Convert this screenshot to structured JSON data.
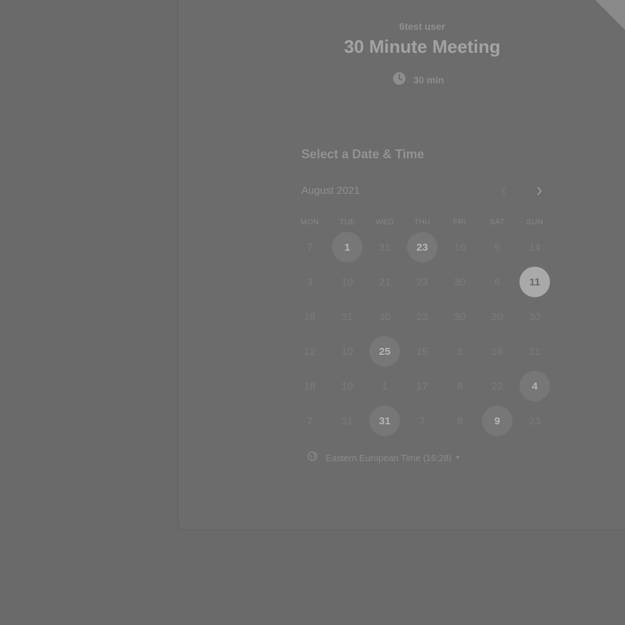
{
  "event": {
    "host": "6test user",
    "title": "30 Minute Meeting",
    "duration": "30 min",
    "duration_icon": "clock-icon"
  },
  "picker": {
    "heading": "Select a Date & Time",
    "month": "August 2021",
    "prev_icon": "chevron-left-icon",
    "next_icon": "chevron-right-icon",
    "weekdays": [
      "MON",
      "TUE",
      "WED",
      "THU",
      "FRI",
      "SAT",
      "SUN"
    ],
    "weeks": [
      [
        {
          "d": "7"
        },
        {
          "d": "1",
          "state": "available"
        },
        {
          "d": "31"
        },
        {
          "d": "23",
          "state": "available"
        },
        {
          "d": "16"
        },
        {
          "d": "5"
        },
        {
          "d": "14"
        }
      ],
      [
        {
          "d": "3"
        },
        {
          "d": "10"
        },
        {
          "d": "21"
        },
        {
          "d": "23"
        },
        {
          "d": "30"
        },
        {
          "d": "6"
        },
        {
          "d": "11",
          "state": "selected"
        }
      ],
      [
        {
          "d": "18"
        },
        {
          "d": "31"
        },
        {
          "d": "30"
        },
        {
          "d": "23"
        },
        {
          "d": "30"
        },
        {
          "d": "20"
        },
        {
          "d": "30"
        }
      ],
      [
        {
          "d": "12"
        },
        {
          "d": "10"
        },
        {
          "d": "25",
          "state": "available"
        },
        {
          "d": "15"
        },
        {
          "d": "3"
        },
        {
          "d": "16"
        },
        {
          "d": "21"
        }
      ],
      [
        {
          "d": "18"
        },
        {
          "d": "10"
        },
        {
          "d": "1"
        },
        {
          "d": "17"
        },
        {
          "d": "8"
        },
        {
          "d": "22"
        },
        {
          "d": "4",
          "state": "available"
        }
      ],
      [
        {
          "d": "7"
        },
        {
          "d": "31"
        },
        {
          "d": "31",
          "state": "available"
        },
        {
          "d": "7"
        },
        {
          "d": "9"
        },
        {
          "d": "9",
          "state": "available"
        },
        {
          "d": "23"
        }
      ]
    ]
  },
  "timezone": {
    "label": "Eastern European Time (16:28)",
    "icon": "globe-icon"
  },
  "colors": {
    "backdrop": "#6a6a6a",
    "selected_day": "#a9a9a9",
    "available_day": "#777777"
  }
}
